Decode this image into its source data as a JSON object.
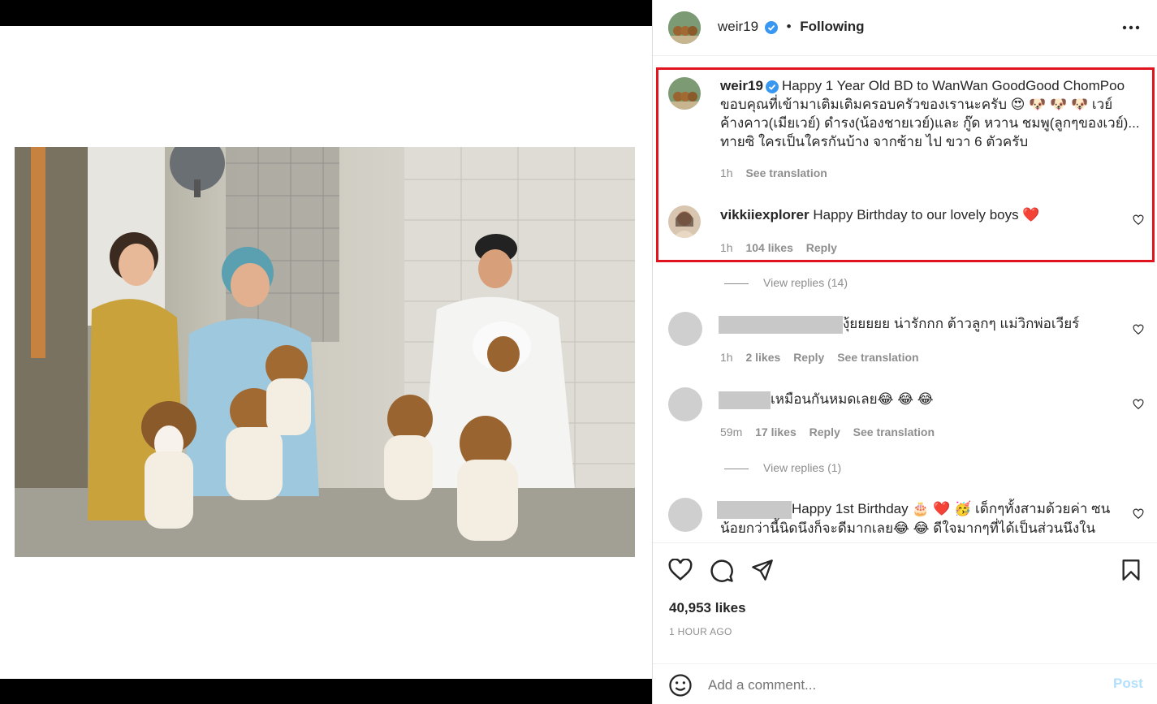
{
  "post": {
    "username": "weir19",
    "separator": "•",
    "follow_status": "Following",
    "more_icon": "more-horizontal-icon"
  },
  "caption": {
    "username": "weir19",
    "line1": "Happy 1 Year Old BD to WanWan GoodGood ChomPoo",
    "line2": "ขอบคุณที่เข้ามาเติมเติมครอบครัวของเรานะครับ 😍 🐶 🐶 🐶  เวย์",
    "line3": "ค้างคาว(เมียเวย์) ดำรง(น้องชายเวย์)และ กู๊ด หวาน ชมพู(ลูกๆของเวย์)...",
    "line4": "ทายซิ ใครเป็นใครกันบ้าง จากซ้าย ไป ขวา 6 ตัวครับ",
    "time": "1h",
    "see_translation": "See translation"
  },
  "comments": [
    {
      "username": "vikkiiexplorer",
      "text": "Happy Birthday to our lovely boys",
      "emoji": "❤️",
      "time": "1h",
      "likes": "104 likes",
      "reply": "Reply",
      "view_replies": "View replies (14)"
    },
    {
      "text": "งุ้ยยยยย น่ารักกก ต้าวลูกๆ แม่วิกพ่อเวียร์",
      "time": "1h",
      "likes": "2 likes",
      "reply": "Reply",
      "see_translation": "See translation"
    },
    {
      "text": "เหมือนกันหมดเลย😂 😂 😂",
      "time": "59m",
      "likes": "17 likes",
      "reply": "Reply",
      "see_translation": "See translation",
      "view_replies": "View replies (1)"
    },
    {
      "line1": "Happy 1st Birthday 🎂 ❤️ 🥳  เด็กๆทั้งสามด้วยค่า ซน",
      "line2": "น้อยกว่านี้นิดนึงก็จะดีมากเลย😂 😂  ดีใจมากๆที่ได้เป็นส่วนนึงใน"
    }
  ],
  "footer": {
    "likes": "40,953 likes",
    "timestamp": "1 HOUR AGO",
    "comment_placeholder": "Add a comment...",
    "post_button": "Post"
  },
  "colors": {
    "highlight_border": "#e0141e",
    "verified": "#3897f0",
    "heart": "#ed4956",
    "post_disabled": "#b2dffc"
  }
}
